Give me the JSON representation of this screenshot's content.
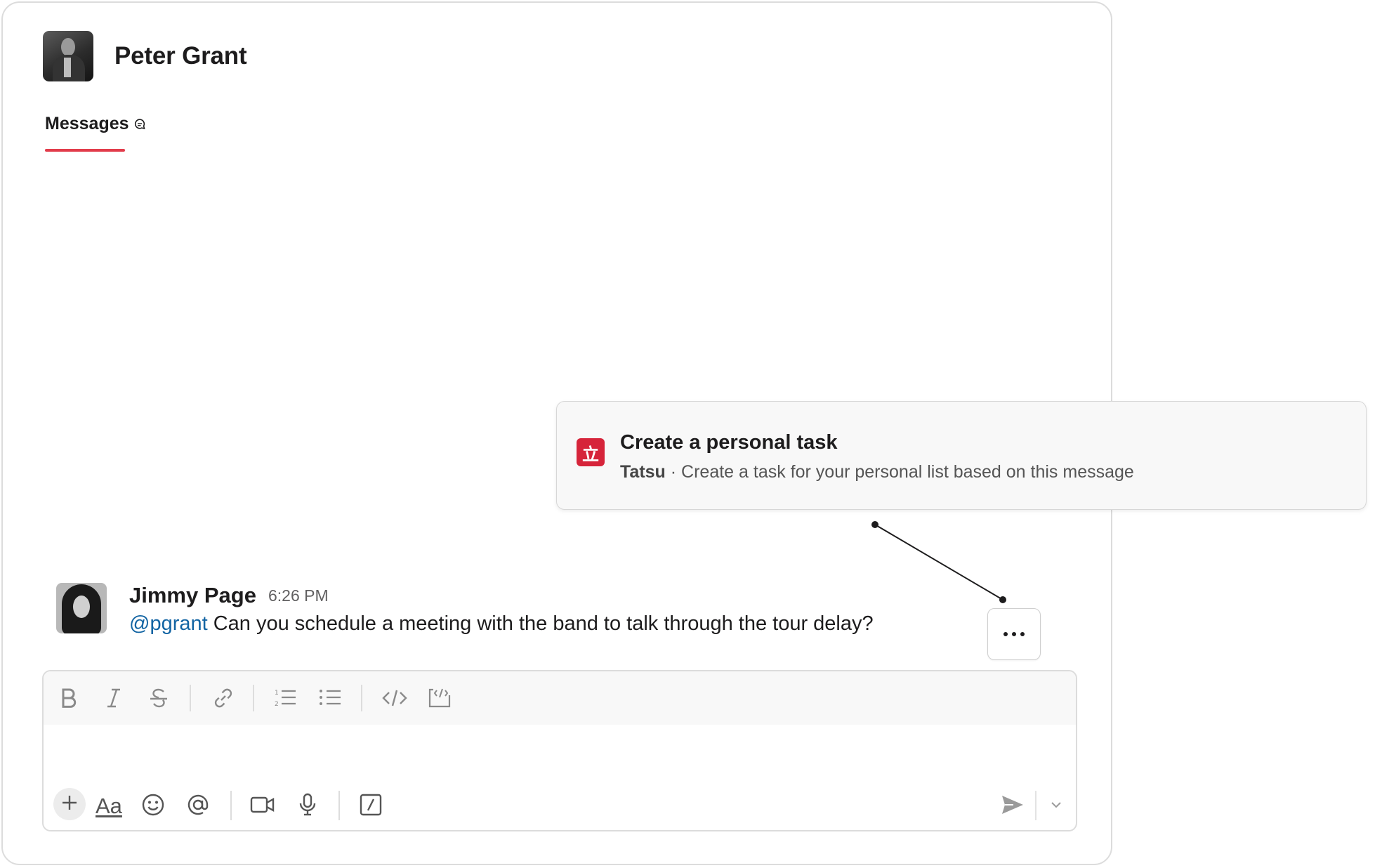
{
  "dm": {
    "name": "Peter Grant",
    "avatar_icon": "person-avatar"
  },
  "tabs": [
    {
      "label": "Messages",
      "icon": "chat-bubble-icon",
      "active": true
    }
  ],
  "popup": {
    "icon": "tatsu-app-icon",
    "icon_glyph": "立",
    "title": "Create a personal task",
    "app": "Tatsu",
    "separator": " · ",
    "description": "Create a task for your personal list based on this message"
  },
  "message": {
    "author": "Jimmy Page",
    "time": "6:26 PM",
    "mention": "@pgrant",
    "text": " Can you schedule a meeting with the band to talk through the tour delay?"
  },
  "message_actions": {
    "more_icon": "more-actions-icon"
  },
  "composer": {
    "format_tools": [
      "bold",
      "italic",
      "strikethrough",
      "link",
      "ordered-list",
      "bulleted-list",
      "code",
      "code-block"
    ],
    "bottom_tools": [
      "add",
      "formatting",
      "emoji",
      "mention",
      "video",
      "audio",
      "slash-command"
    ],
    "formatting_label": "Aa"
  },
  "colors": {
    "accent_red": "#e23c4b",
    "app_icon_red": "#d6243a",
    "mention_blue": "#1264a3"
  }
}
